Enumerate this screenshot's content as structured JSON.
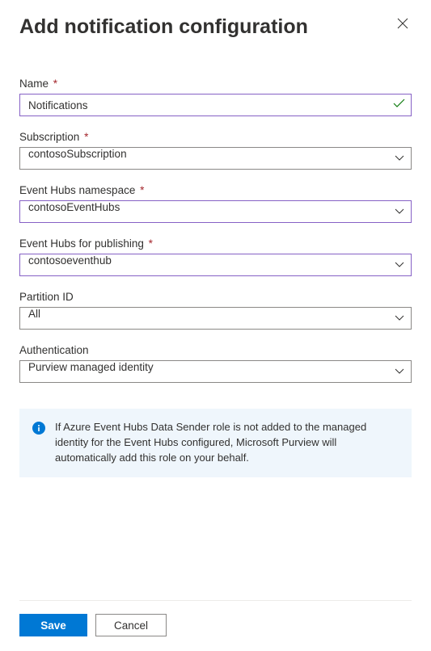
{
  "header": {
    "title": "Add notification configuration"
  },
  "fields": {
    "name": {
      "label": "Name",
      "value": "Notifications",
      "required": true
    },
    "subscription": {
      "label": "Subscription",
      "value": "contosoSubscription",
      "required": true
    },
    "eventHubsNamespace": {
      "label": "Event Hubs namespace",
      "value": "contosoEventHubs",
      "required": true
    },
    "eventHubsPublishing": {
      "label": "Event Hubs for publishing",
      "value": "contosoeventhub",
      "required": true
    },
    "partitionId": {
      "label": "Partition ID",
      "value": "All",
      "required": false
    },
    "authentication": {
      "label": "Authentication",
      "value": "Purview managed identity",
      "required": false
    }
  },
  "info": {
    "text": "If Azure Event Hubs Data Sender role is not added to the managed identity for the Event Hubs configured, Microsoft Purview will automatically add this role on your behalf."
  },
  "footer": {
    "save": "Save",
    "cancel": "Cancel"
  },
  "requiredMark": "*"
}
